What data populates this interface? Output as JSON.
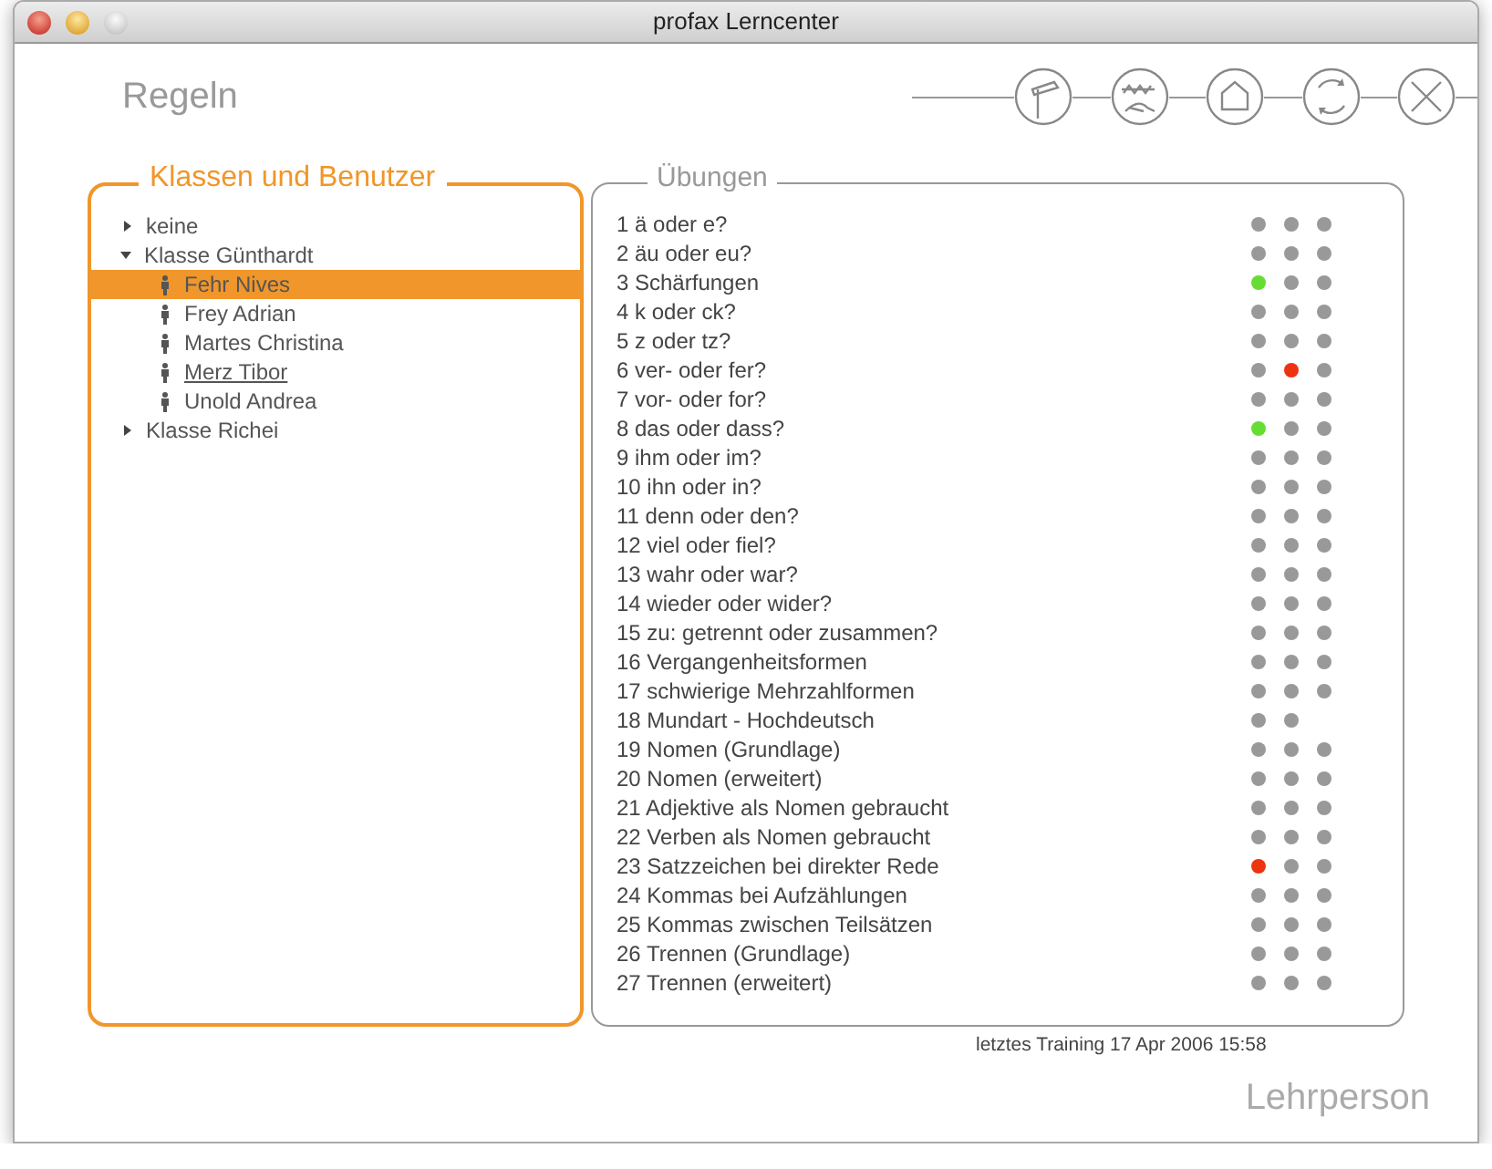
{
  "window": {
    "title": "profax Lerncenter"
  },
  "header": {
    "title": "Regeln"
  },
  "users_panel": {
    "title": "Klassen und Benutzer",
    "tree": [
      {
        "label": "keine",
        "kind": "group",
        "expanded": false
      },
      {
        "label": "Klasse Günthardt",
        "kind": "group",
        "expanded": true,
        "children": [
          {
            "label": "Fehr Nives",
            "kind": "user",
            "selected": true,
            "underlined": false
          },
          {
            "label": "Frey Adrian",
            "kind": "user",
            "selected": false,
            "underlined": false
          },
          {
            "label": "Martes Christina",
            "kind": "user",
            "selected": false,
            "underlined": false
          },
          {
            "label": "Merz Tibor",
            "kind": "user",
            "selected": false,
            "underlined": true
          },
          {
            "label": "Unold Andrea",
            "kind": "user",
            "selected": false,
            "underlined": false
          }
        ]
      },
      {
        "label": "Klasse Richei",
        "kind": "group",
        "expanded": false
      }
    ]
  },
  "exercises_panel": {
    "title": "Übungen",
    "exercises": [
      {
        "label": "1 ä oder e?",
        "dots": [
          {
            "color": "#999999"
          },
          {
            "color": "#999999"
          },
          {
            "color": "#999999"
          }
        ]
      },
      {
        "label": "2 äu oder eu?",
        "dots": [
          {
            "color": "#999999"
          },
          {
            "color": "#999999"
          },
          {
            "color": "#999999"
          }
        ]
      },
      {
        "label": "3 Schärfungen",
        "dots": [
          {
            "color": "#66dd33"
          },
          {
            "color": "#999999"
          },
          {
            "color": "#999999"
          }
        ]
      },
      {
        "label": "4 k oder ck?",
        "dots": [
          {
            "color": "#999999"
          },
          {
            "color": "#999999"
          },
          {
            "color": "#999999"
          }
        ]
      },
      {
        "label": "5 z oder tz?",
        "dots": [
          {
            "color": "#999999"
          },
          {
            "color": "#999999"
          },
          {
            "color": "#999999"
          }
        ]
      },
      {
        "label": "6 ver- oder fer?",
        "dots": [
          {
            "color": "#999999"
          },
          {
            "color": "#ee3311"
          },
          {
            "color": "#999999"
          }
        ]
      },
      {
        "label": "7 vor- oder for?",
        "dots": [
          {
            "color": "#999999"
          },
          {
            "color": "#999999"
          },
          {
            "color": "#999999"
          }
        ]
      },
      {
        "label": "8 das oder dass?",
        "dots": [
          {
            "color": "#66dd33"
          },
          {
            "color": "#999999"
          },
          {
            "color": "#999999"
          }
        ]
      },
      {
        "label": "9 ihm oder im?",
        "dots": [
          {
            "color": "#999999"
          },
          {
            "color": "#999999"
          },
          {
            "color": "#999999"
          }
        ]
      },
      {
        "label": "10 ihn oder in?",
        "dots": [
          {
            "color": "#999999"
          },
          {
            "color": "#999999"
          },
          {
            "color": "#999999"
          }
        ]
      },
      {
        "label": "11 denn oder den?",
        "dots": [
          {
            "color": "#999999"
          },
          {
            "color": "#999999"
          },
          {
            "color": "#999999"
          }
        ]
      },
      {
        "label": "12 viel oder fiel?",
        "dots": [
          {
            "color": "#999999"
          },
          {
            "color": "#999999"
          },
          {
            "color": "#999999"
          }
        ]
      },
      {
        "label": "13 wahr oder war?",
        "dots": [
          {
            "color": "#999999"
          },
          {
            "color": "#999999"
          },
          {
            "color": "#999999"
          }
        ]
      },
      {
        "label": "14 wieder oder wider?",
        "dots": [
          {
            "color": "#999999"
          },
          {
            "color": "#999999"
          },
          {
            "color": "#999999"
          }
        ]
      },
      {
        "label": "15 zu: getrennt oder zusammen?",
        "dots": [
          {
            "color": "#999999"
          },
          {
            "color": "#999999"
          },
          {
            "color": "#999999"
          }
        ]
      },
      {
        "label": "16 Vergangenheitsformen",
        "dots": [
          {
            "color": "#999999"
          },
          {
            "color": "#999999"
          },
          {
            "color": "#999999"
          }
        ]
      },
      {
        "label": "17 schwierige Mehrzahlformen",
        "dots": [
          {
            "color": "#999999"
          },
          {
            "color": "#999999"
          },
          {
            "color": "#999999"
          }
        ]
      },
      {
        "label": "18 Mundart - Hochdeutsch",
        "dots": [
          {
            "color": "#999999"
          },
          {
            "color": "#999999"
          }
        ]
      },
      {
        "label": "19 Nomen (Grundlage)",
        "dots": [
          {
            "color": "#999999"
          },
          {
            "color": "#999999"
          },
          {
            "color": "#999999"
          }
        ]
      },
      {
        "label": "20 Nomen (erweitert)",
        "dots": [
          {
            "color": "#999999"
          },
          {
            "color": "#999999"
          },
          {
            "color": "#999999"
          }
        ]
      },
      {
        "label": "21 Adjektive als Nomen gebraucht",
        "dots": [
          {
            "color": "#999999"
          },
          {
            "color": "#999999"
          },
          {
            "color": "#999999"
          }
        ]
      },
      {
        "label": "22 Verben als Nomen gebraucht",
        "dots": [
          {
            "color": "#999999"
          },
          {
            "color": "#999999"
          },
          {
            "color": "#999999"
          }
        ]
      },
      {
        "label": "23 Satzzeichen bei direkter Rede",
        "dots": [
          {
            "color": "#ee3311"
          },
          {
            "color": "#999999"
          },
          {
            "color": "#999999"
          }
        ]
      },
      {
        "label": "24 Kommas bei Aufzählungen",
        "dots": [
          {
            "color": "#999999"
          },
          {
            "color": "#999999"
          },
          {
            "color": "#999999"
          }
        ]
      },
      {
        "label": "25 Kommas zwischen Teilsätzen",
        "dots": [
          {
            "color": "#999999"
          },
          {
            "color": "#999999"
          },
          {
            "color": "#999999"
          }
        ]
      },
      {
        "label": "26 Trennen (Grundlage)",
        "dots": [
          {
            "color": "#999999"
          },
          {
            "color": "#999999"
          },
          {
            "color": "#999999"
          }
        ]
      },
      {
        "label": "27 Trennen (erweitert)",
        "dots": [
          {
            "color": "#999999"
          },
          {
            "color": "#999999"
          },
          {
            "color": "#999999"
          }
        ]
      }
    ]
  },
  "last_training": "letztes Training 17 Apr 2006 15:58",
  "footer": {
    "role": "Lehrperson"
  }
}
